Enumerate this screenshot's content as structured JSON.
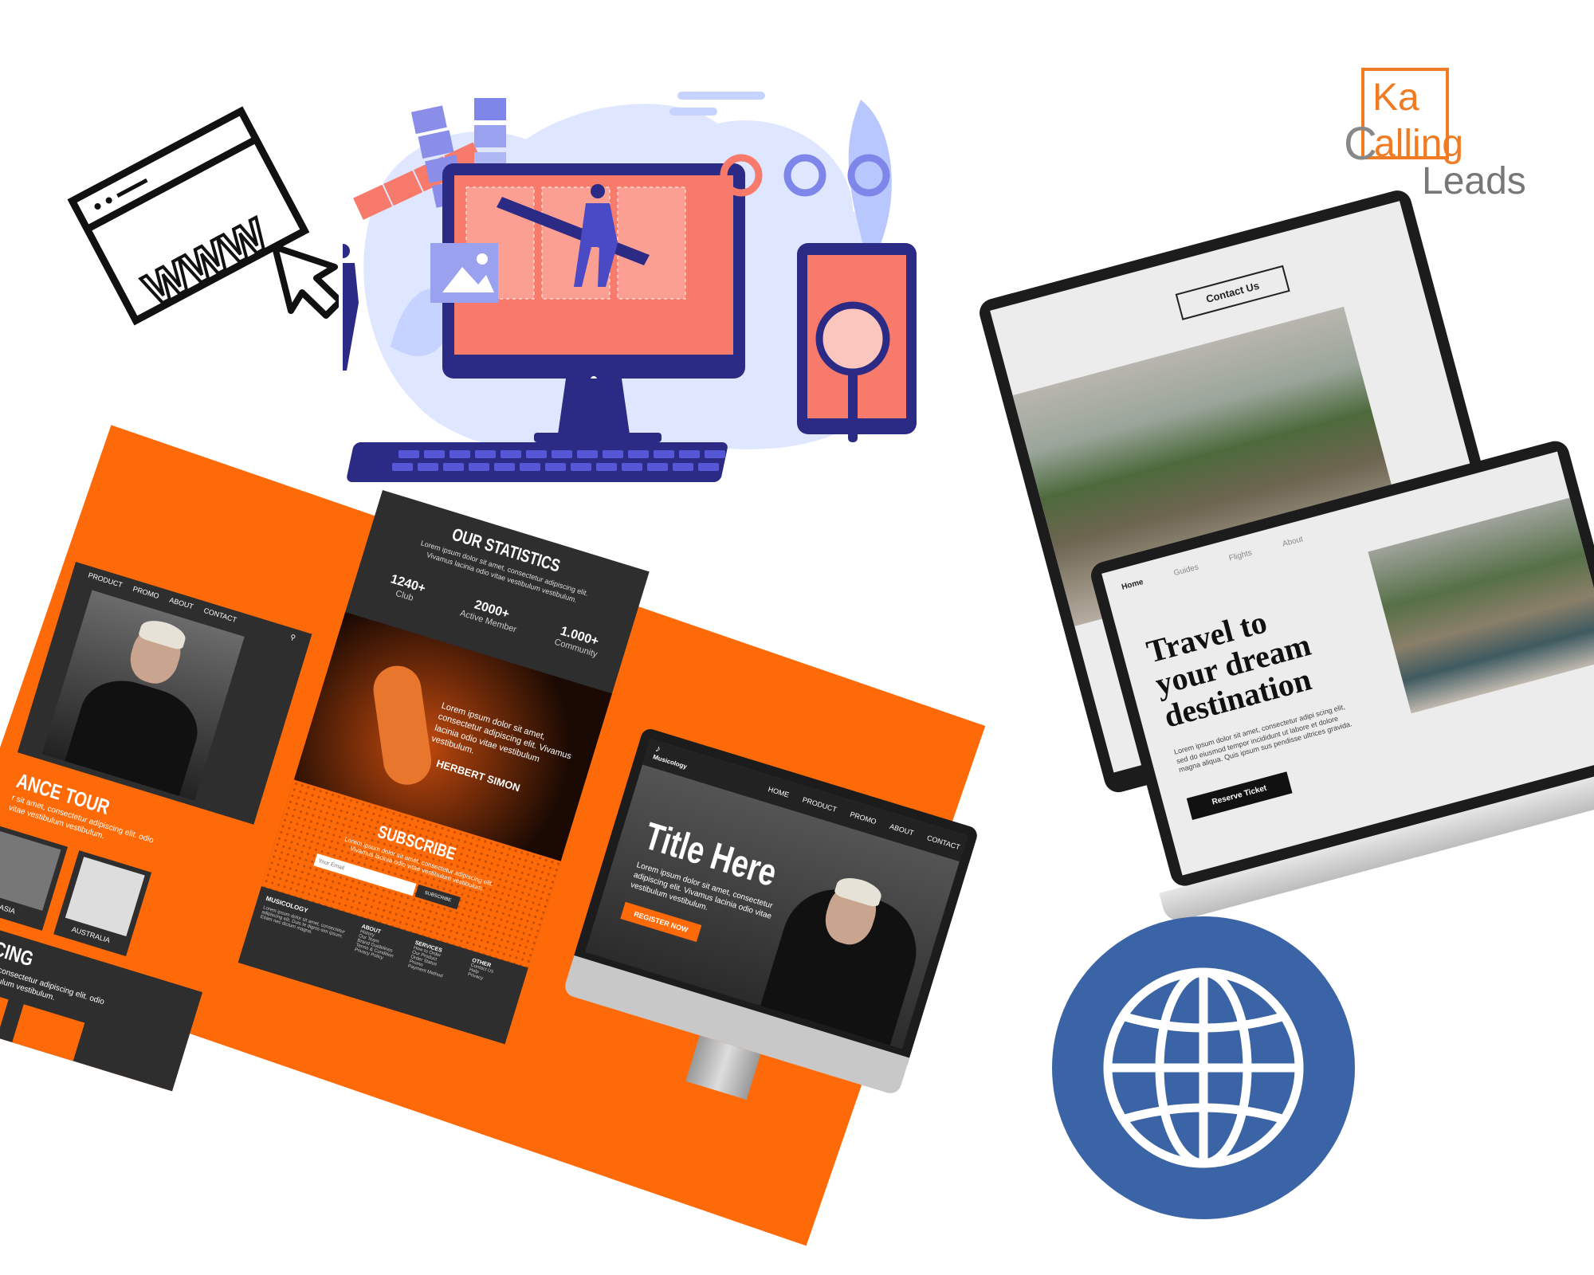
{
  "logo": {
    "line1": "Ka",
    "line2": "alling",
    "line3": "Leads",
    "initial": "C"
  },
  "www_icon": {
    "label": "WWW",
    "icon": "browser-window-icon"
  },
  "illustration": {
    "icon": "web-design-illustration"
  },
  "orange_mockup": {
    "nav": [
      "PRODUCT",
      "PROMO",
      "ABOUT",
      "CONTACT"
    ],
    "dance_tour_title": "ANCE TOUR",
    "dance_tour_text": "r sit amet, consectetur adipiscing elit. odio vitae vestibulum vestibulum.",
    "tour_labels": [
      "ASIA",
      "AUSTRALIA"
    ],
    "pricing_title": "PRICING",
    "pricing_text": "r sit amet, consectetur adipiscing elit. odio vitae vestibulum vestibulum.",
    "stats_title": "OUR STATISTICS",
    "stats_text": "Lorem ipsum dolor sit amet, consectetur adipiscing elit. Vivamus lacinia odio vitae vestibulum vestibulum.",
    "stats": [
      {
        "value": "1240+",
        "label": "Club"
      },
      {
        "value": "2000+",
        "label": "Active Member"
      },
      {
        "value": "1.000+",
        "label": "Community"
      }
    ],
    "dancer_text": "Lorem ipsum dolor sit amet, consectetur adipiscing elit. Vivamus lacinia odio vitae vestibulum vestibulum.",
    "dancer_name": "HERBERT SIMON",
    "subscribe_title": "SUBSCRIBE",
    "subscribe_text": "Lorem ipsum dolor sit amet, consectetur adipiscing elit. Vivamus lacinia odio vitae vestibulum vestibulum.",
    "subscribe_placeholder": "Your Email",
    "subscribe_button": "SUBSCRIBE",
    "footer_brand": "MUSICOLOGY",
    "footer_text": "Lorem ipsum dolor sit amet, consectetur adipiscing elit. Duis te dignis-sim ipsum. Etiam nec dictum magna.",
    "footer_cols": [
      {
        "title": "ABOUT",
        "items": [
          "History",
          "Our Team",
          "Brand Guidelines",
          "Terms & Condition",
          "Privacy Policy"
        ]
      },
      {
        "title": "SERVICES",
        "items": [
          "How to Order",
          "Our Product",
          "Order Status",
          "Promo",
          "Payment Method"
        ]
      },
      {
        "title": "OTHER",
        "items": [
          "Contact Us",
          "Help",
          "Privacy"
        ]
      }
    ]
  },
  "monitor": {
    "brand": "Musicology",
    "nav": [
      "HOME",
      "PRODUCT",
      "PROMO",
      "ABOUT",
      "CONTACT"
    ],
    "title": "Title Here",
    "text": "Lorem ipsum dolor sit amet, consectetur adipiscing elit. Vivamus lacinia odio vitae vestibulum vestibulum.",
    "cta": "REGISTER NOW"
  },
  "laptop_back": {
    "contact_button": "Contact Us"
  },
  "laptop_front": {
    "nav": [
      "Home",
      "Guides",
      "Flights",
      "About"
    ],
    "heading": [
      "Travel to",
      "your dream",
      "destination"
    ],
    "body": "Lorem ipsum dolor sit amet, consectetur adipi scing elit, sed do eiusmod tempor incididunt ut labore et dolore magna aliqua. Quis ipsum sus pendisse ultrices gravida.",
    "cta": "Reserve Ticket"
  },
  "globe": {
    "icon": "globe-icon"
  },
  "colors": {
    "orange": "#ff6a08",
    "dark": "#2e2e2e",
    "blue_globe": "#3b64a6",
    "salmon": "#f87a6a",
    "navy": "#2b2a85",
    "logo_orange": "#f07b22"
  }
}
